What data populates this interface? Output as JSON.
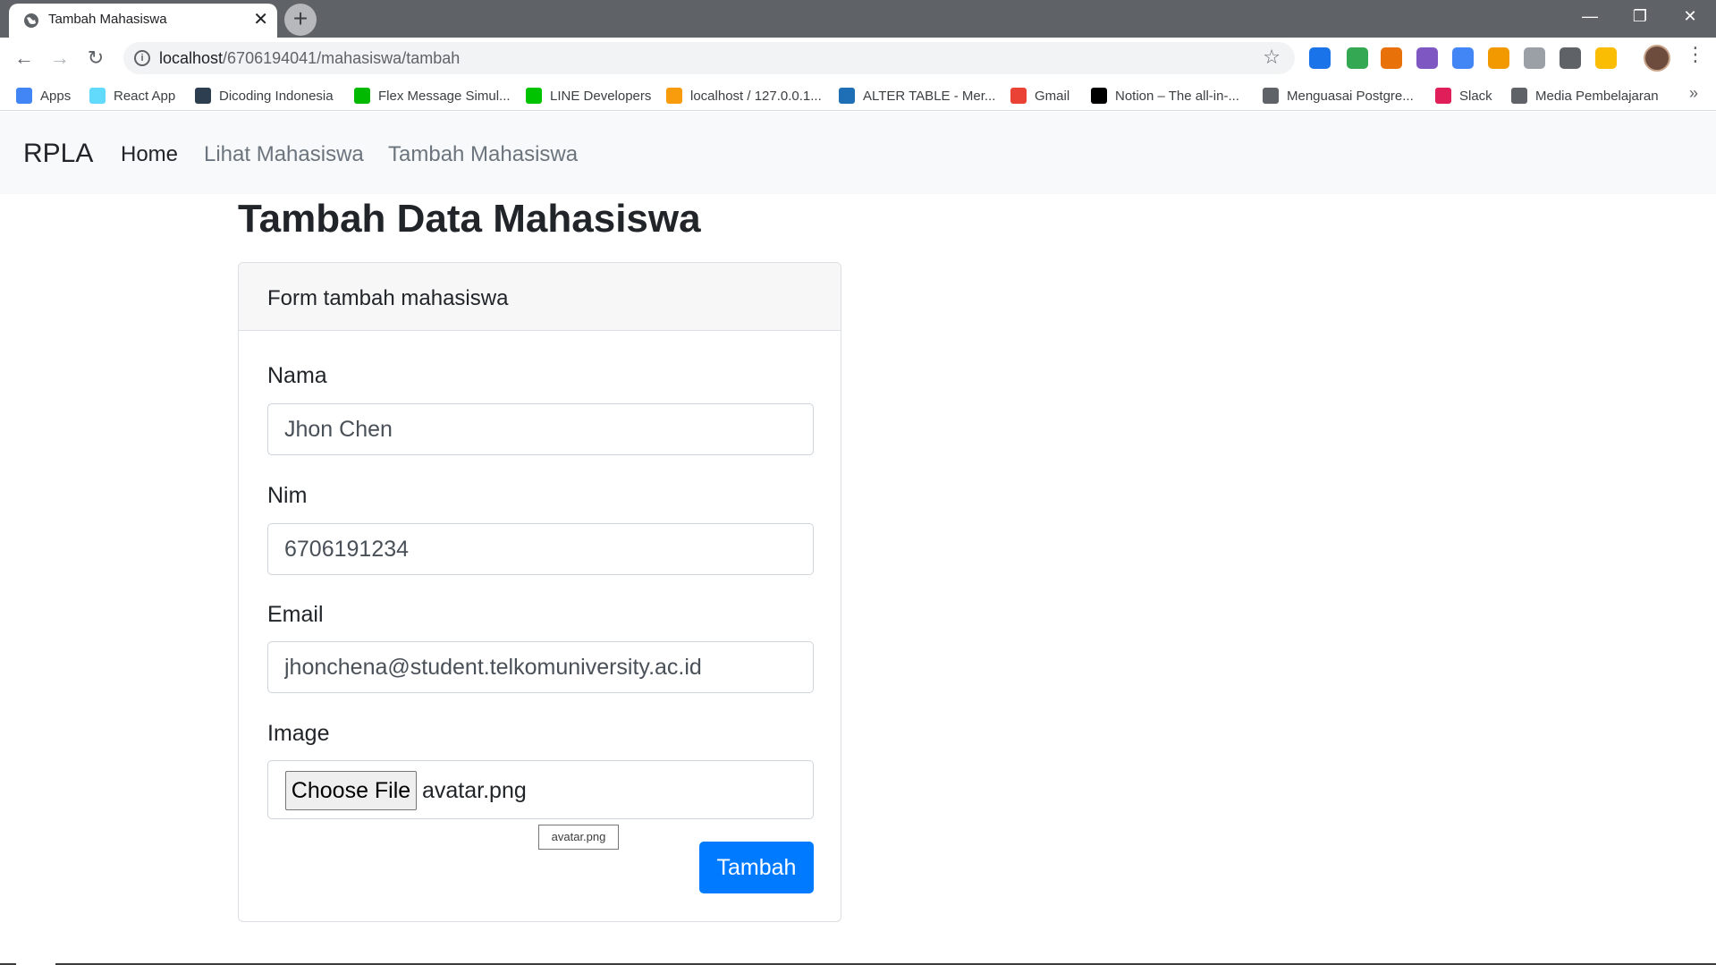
{
  "browser": {
    "tab_title": "Tambah Mahasiswa",
    "tab_close": "✕",
    "new_tab": "+",
    "url_host": "localhost",
    "url_path": "/6706194041/mahasiswa/tambah",
    "window_controls": {
      "minimize": "—",
      "restore": "❐",
      "close": "✕"
    },
    "extension_colors": [
      "#1a73e8",
      "#34a853",
      "#e8710a",
      "#7e57c2",
      "#4285f4",
      "#f29900",
      "#9aa0a6",
      "#5f6368",
      "#fbbc04"
    ],
    "bookmarks": [
      {
        "label": "Apps",
        "icon": "apps-grid-icon",
        "color": "#4285f4"
      },
      {
        "label": "React App",
        "icon": "react-icon",
        "color": "#61dafb"
      },
      {
        "label": "Dicoding Indonesia",
        "icon": "dicoding-icon",
        "color": "#2d3e50"
      },
      {
        "label": "Flex Message Simul...",
        "icon": "code-icon",
        "color": "#00b900"
      },
      {
        "label": "LINE Developers",
        "icon": "line-icon",
        "color": "#00c300"
      },
      {
        "label": "localhost / 127.0.0.1...",
        "icon": "phpmyadmin-icon",
        "color": "#f89c0e"
      },
      {
        "label": "ALTER TABLE - Mer...",
        "icon": "globe-icon",
        "color": "#1e6fb5"
      },
      {
        "label": "Gmail",
        "icon": "gmail-icon",
        "color": "#ea4335"
      },
      {
        "label": "Notion – The all-in-...",
        "icon": "notion-icon",
        "color": "#000000"
      },
      {
        "label": "Menguasai Postgre...",
        "icon": "feather-icon",
        "color": "#5f6368"
      },
      {
        "label": "Slack",
        "icon": "slack-icon",
        "color": "#e01e5a"
      },
      {
        "label": "Media Pembelajaran",
        "icon": "globe-icon",
        "color": "#5f6368"
      }
    ],
    "bookmarks_more": "»"
  },
  "navbar": {
    "brand": "RPLA",
    "links": [
      "Home",
      "Lihat Mahasiswa",
      "Tambah Mahasiswa"
    ]
  },
  "page": {
    "title": "Tambah Data Mahasiswa"
  },
  "form": {
    "header": "Form tambah mahasiswa",
    "nama_label": "Nama",
    "nama_value": "Jhon Chen",
    "nim_label": "Nim",
    "nim_value": "6706191234",
    "email_label": "Email",
    "email_value": "jhonchena@student.telkomuniversity.ac.id",
    "image_label": "Image",
    "choose_file": "Choose File",
    "file_name": "avatar.png",
    "tooltip": "avatar.png",
    "submit": "Tambah"
  },
  "colors": {
    "primary": "#007bff",
    "navbar_bg": "#f8f9fa",
    "chrome_frame": "#5f6368"
  }
}
